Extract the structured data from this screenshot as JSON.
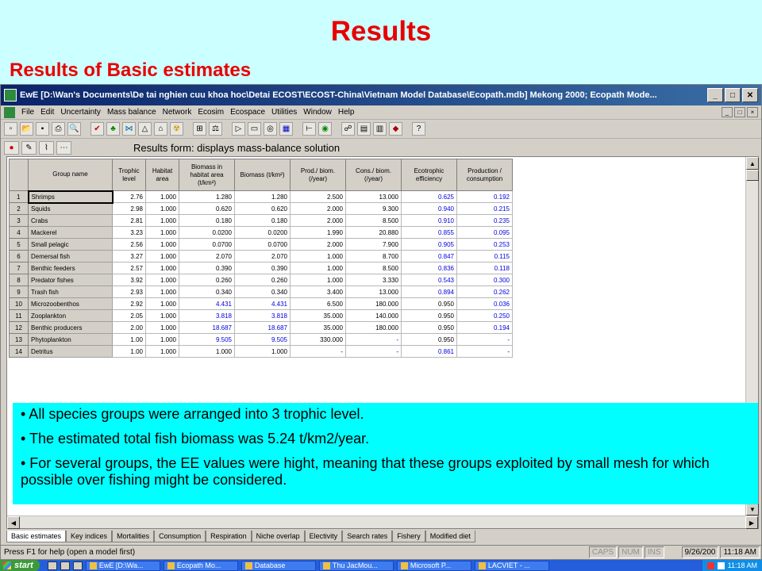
{
  "slide": {
    "title": "Results",
    "subtitle": "Results of Basic estimates"
  },
  "window": {
    "title": "EwE [D:\\Wan's Documents\\De tai nghien cuu khoa hoc\\Detai ECOST\\ECOST-China\\Vietnam Model Database\\Ecopath.mdb] Mekong 2000; Ecopath Mode...",
    "minimize": "_",
    "maximize": "□",
    "close": "✕"
  },
  "menu": {
    "items": [
      "File",
      "Edit",
      "Uncertainty",
      "Mass balance",
      "Network",
      "Ecosim",
      "Ecospace",
      "Utilities",
      "Window",
      "Help"
    ],
    "mdi_min": "_",
    "mdi_max": "□",
    "mdi_close": "×"
  },
  "form": {
    "title": "Results form: displays mass-balance solution"
  },
  "table": {
    "headers": [
      "Group name",
      "Trophic level",
      "Habitat area",
      "Biomass in habitat area (t/km²)",
      "Biomass (t/km²)",
      "Prod./ biom. (/year)",
      "Cons./ biom. (/year)",
      "Ecotrophic efficiency",
      "Production / consumption"
    ],
    "rows": [
      {
        "n": "1",
        "name": "Shrimps",
        "tl": "2.76",
        "ha": "1.000",
        "bha": "1.280",
        "b": "1.280",
        "pb": "2.500",
        "qb": "13.000",
        "ee": "0.625",
        "pq": "0.192"
      },
      {
        "n": "2",
        "name": "Squids",
        "tl": "2.98",
        "ha": "1.000",
        "bha": "0.620",
        "b": "0.620",
        "pb": "2.000",
        "qb": "9.300",
        "ee": "0.940",
        "pq": "0.215"
      },
      {
        "n": "3",
        "name": "Crabs",
        "tl": "2.81",
        "ha": "1.000",
        "bha": "0.180",
        "b": "0.180",
        "pb": "2.000",
        "qb": "8.500",
        "ee": "0.910",
        "pq": "0.235"
      },
      {
        "n": "4",
        "name": "Mackerel",
        "tl": "3.23",
        "ha": "1.000",
        "bha": "0.0200",
        "b": "0.0200",
        "pb": "1.990",
        "qb": "20.880",
        "ee": "0.855",
        "pq": "0.095"
      },
      {
        "n": "5",
        "name": "Small pelagic",
        "tl": "2.56",
        "ha": "1.000",
        "bha": "0.0700",
        "b": "0.0700",
        "pb": "2.000",
        "qb": "7.900",
        "ee": "0.905",
        "pq": "0.253"
      },
      {
        "n": "6",
        "name": "Demersal fish",
        "tl": "3.27",
        "ha": "1.000",
        "bha": "2.070",
        "b": "2.070",
        "pb": "1.000",
        "qb": "8.700",
        "ee": "0.847",
        "pq": "0.115"
      },
      {
        "n": "7",
        "name": "Benthic feeders",
        "tl": "2.57",
        "ha": "1.000",
        "bha": "0.390",
        "b": "0.390",
        "pb": "1.000",
        "qb": "8.500",
        "ee": "0.836",
        "pq": "0.118"
      },
      {
        "n": "8",
        "name": "Predator fishes",
        "tl": "3.92",
        "ha": "1.000",
        "bha": "0.260",
        "b": "0.260",
        "pb": "1.000",
        "qb": "3.330",
        "ee": "0.543",
        "pq": "0.300"
      },
      {
        "n": "9",
        "name": "Trash fish",
        "tl": "2.93",
        "ha": "1.000",
        "bha": "0.340",
        "b": "0.340",
        "pb": "3.400",
        "qb": "13.000",
        "ee": "0.894",
        "pq": "0.262"
      },
      {
        "n": "10",
        "name": "Microzoobenthos",
        "tl": "2.92",
        "ha": "1.000",
        "bha": "4.431",
        "b": "4.431",
        "pb": "6.500",
        "qb": "180.000",
        "ee": "0.950",
        "pq": "0.036"
      },
      {
        "n": "11",
        "name": "Zooplankton",
        "tl": "2.05",
        "ha": "1.000",
        "bha": "3.818",
        "b": "3.818",
        "pb": "35.000",
        "qb": "140.000",
        "ee": "0.950",
        "pq": "0.250"
      },
      {
        "n": "12",
        "name": "Benthic producers",
        "tl": "2.00",
        "ha": "1.000",
        "bha": "18.687",
        "b": "18.687",
        "pb": "35.000",
        "qb": "180.000",
        "ee": "0.950",
        "pq": "0.194"
      },
      {
        "n": "13",
        "name": "Phytoplankton",
        "tl": "1.00",
        "ha": "1.000",
        "bha": "9.505",
        "b": "9.505",
        "pb": "330.000",
        "qb": "-",
        "ee": "0.950",
        "pq": "-"
      },
      {
        "n": "14",
        "name": "Detritus",
        "tl": "1.00",
        "ha": "1.000",
        "bha": "1.000",
        "b": "1.000",
        "pb": "-",
        "qb": "-",
        "ee": "0.861",
        "pq": "-"
      }
    ]
  },
  "info": {
    "bullets": [
      "• All species groups were arranged into 3 trophic level.",
      "• The estimated total fish biomass was 5.24 t/km2/year.",
      "• For several groups, the EE values were hight, meaning that these groups exploited by small mesh for which possible over fishing might be considered."
    ]
  },
  "tabs": [
    "Basic estimates",
    "Key indices",
    "Mortalities",
    "Consumption",
    "Respiration",
    "Niche overlap",
    "Electivity",
    "Search rates",
    "Fishery",
    "Modified diet"
  ],
  "status": {
    "text": "Press F1 for help (open a model first)",
    "caps": "CAPS",
    "num": "NUM",
    "ins": "INS",
    "date": "9/26/200",
    "time": "11:18 AM"
  },
  "taskbar": {
    "start": "start",
    "tasks": [
      "EwE [D:\\Wa...",
      "Ecopath Mo...",
      "Database",
      "Thu JacMou...",
      "Microsoft P...",
      "LACVIET - ..."
    ],
    "clock": "11:18 AM"
  }
}
